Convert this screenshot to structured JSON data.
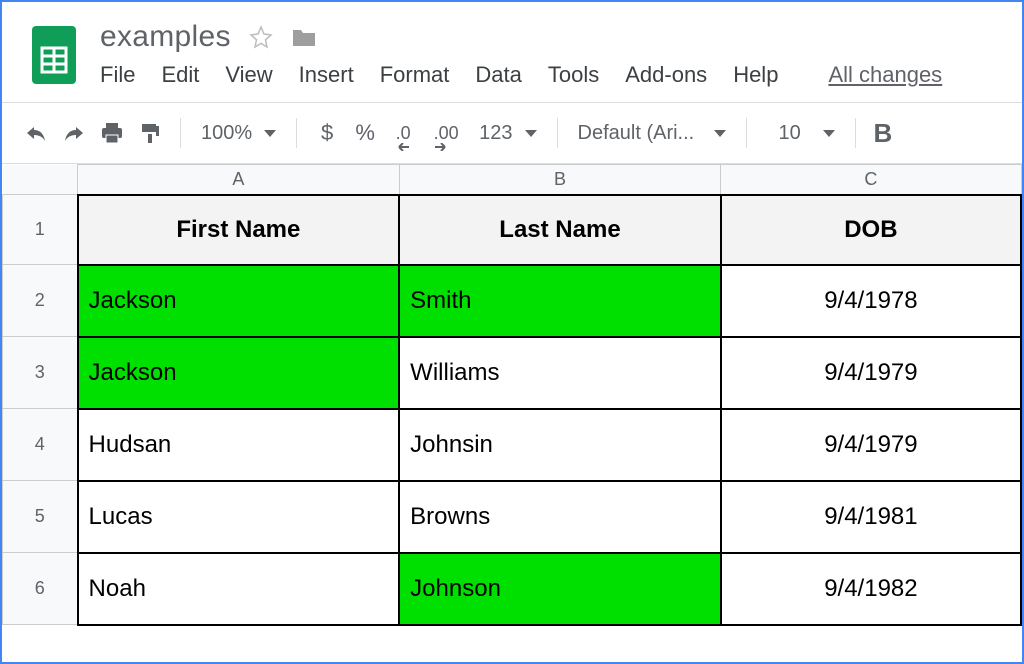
{
  "doc": {
    "title": "examples"
  },
  "menu": {
    "file": "File",
    "edit": "Edit",
    "view": "View",
    "insert": "Insert",
    "format": "Format",
    "data": "Data",
    "tools": "Tools",
    "addons": "Add-ons",
    "help": "Help",
    "changes": "All changes"
  },
  "toolbar": {
    "zoom": "100%",
    "currency": "$",
    "percent": "%",
    "dec_dec": ".0",
    "inc_dec": ".00",
    "more_formats": "123",
    "font": "Default (Ari...",
    "font_size": "10",
    "bold": "B"
  },
  "sheet": {
    "columns": [
      "A",
      "B",
      "C"
    ],
    "rows": [
      "1",
      "2",
      "3",
      "4",
      "5",
      "6"
    ],
    "headers": {
      "col_a": "First Name",
      "col_b": "Last Name",
      "col_c": "DOB"
    },
    "data": [
      {
        "first": "Jackson",
        "last": "Smith",
        "dob": "9/4/1978",
        "hl_first": true,
        "hl_last": true
      },
      {
        "first": "Jackson",
        "last": "Williams",
        "dob": "9/4/1979",
        "hl_first": true,
        "hl_last": false
      },
      {
        "first": "Hudsan",
        "last": "Johnsin",
        "dob": "9/4/1979",
        "hl_first": false,
        "hl_last": false
      },
      {
        "first": "Lucas",
        "last": "Browns",
        "dob": "9/4/1981",
        "hl_first": false,
        "hl_last": false
      },
      {
        "first": "Noah",
        "last": "Johnson",
        "dob": "9/4/1982",
        "hl_first": false,
        "hl_last": true
      }
    ]
  },
  "colors": {
    "highlight": "#00e000",
    "brand": "#0f9d58"
  }
}
